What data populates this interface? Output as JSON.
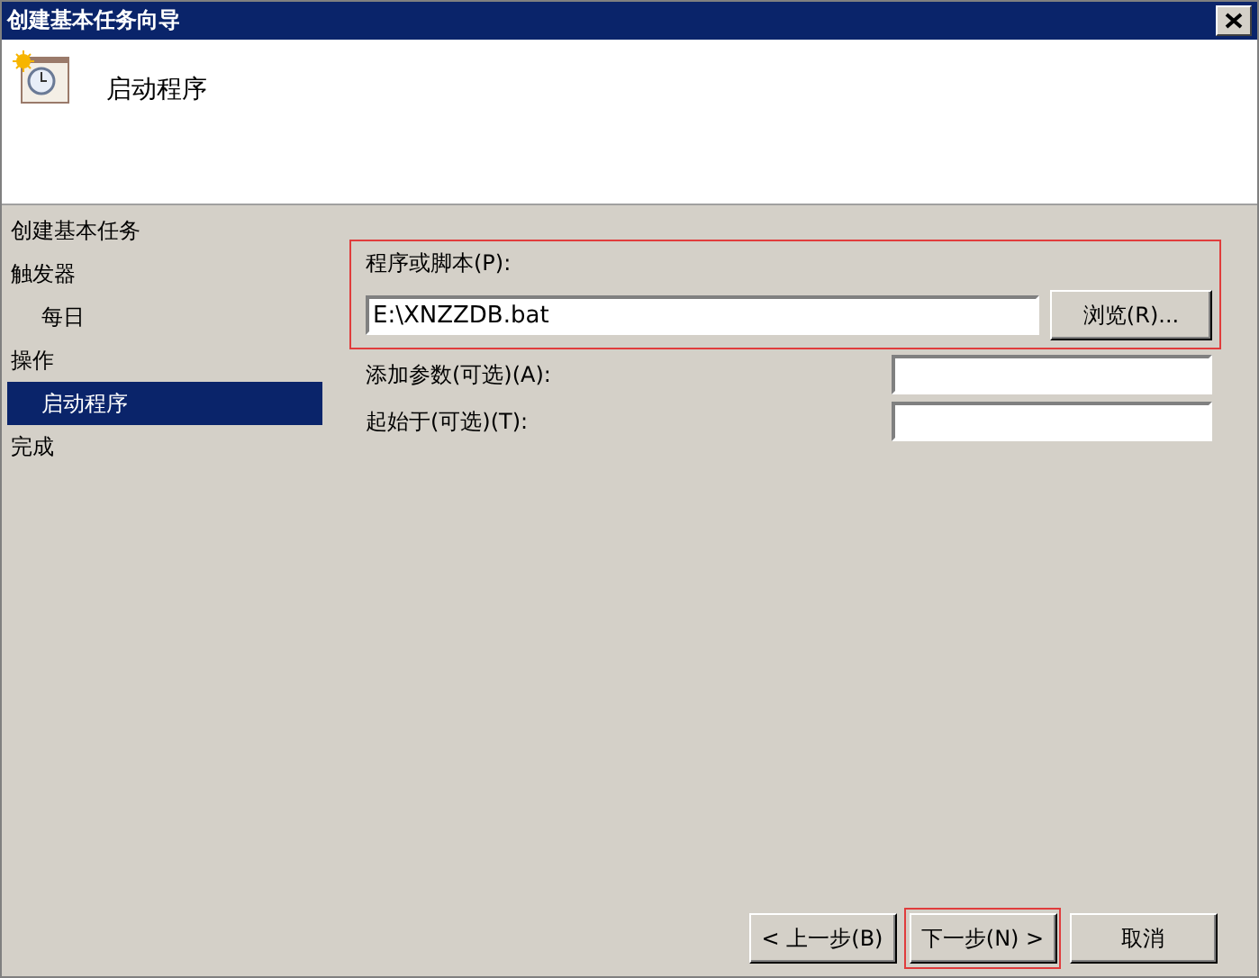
{
  "window": {
    "title": "创建基本任务向导"
  },
  "header": {
    "title": "启动程序"
  },
  "sidebar": {
    "items": [
      {
        "label": "创建基本任务",
        "selected": false
      },
      {
        "label": "触发器",
        "selected": false,
        "children": [
          {
            "label": "每日",
            "selected": false
          }
        ]
      },
      {
        "label": "操作",
        "selected": false,
        "children": [
          {
            "label": "启动程序",
            "selected": true
          }
        ]
      },
      {
        "label": "完成",
        "selected": false
      }
    ]
  },
  "program": {
    "label": "程序或脚本(P):",
    "value": "E:\\XNZZDB.bat",
    "browse_button": "浏览(R)...",
    "highlighted": true
  },
  "fields": [
    {
      "label": "添加参数(可选)(A):"
    },
    {
      "label": "起始于(可选)(T):"
    }
  ],
  "buttons": [
    {
      "label": "< 上一步(B)",
      "highlighted": false
    },
    {
      "label": "下一步(N) >",
      "highlighted": true
    },
    {
      "label": "取消",
      "highlighted": false
    }
  ]
}
